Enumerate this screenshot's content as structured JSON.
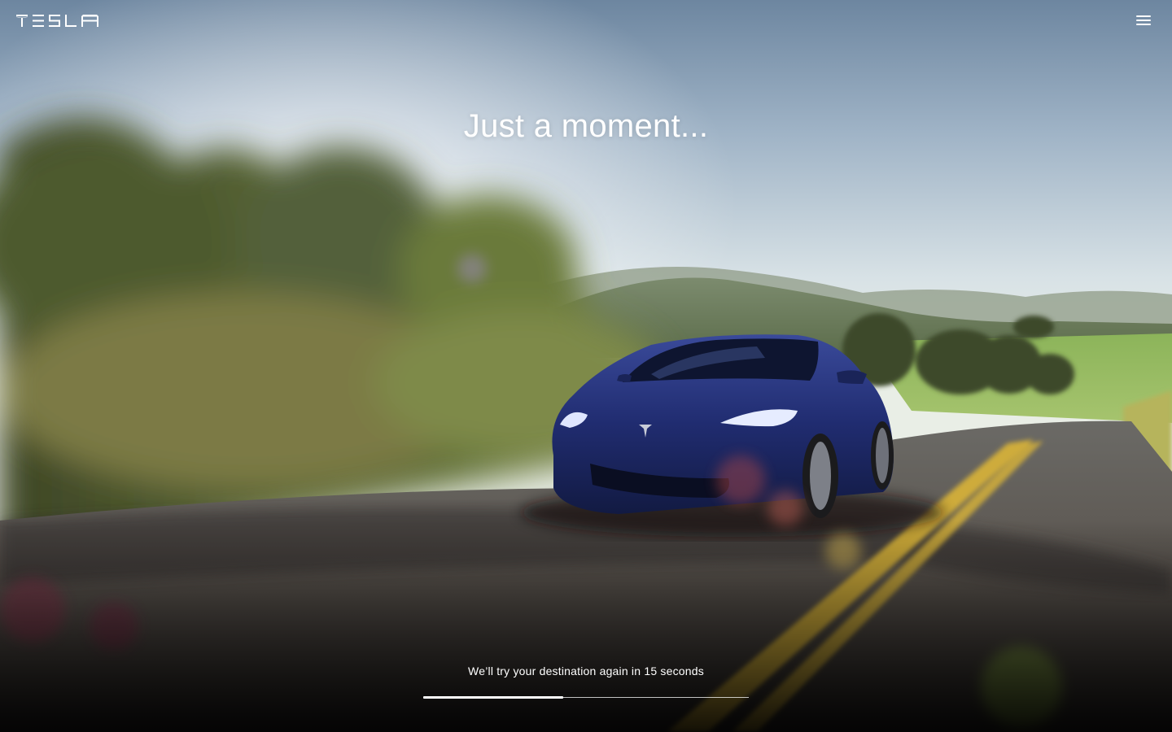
{
  "header": {
    "logo_text": "TESLA",
    "logo_icon": "tesla-wordmark-icon",
    "menu_icon": "hamburger-menu-icon"
  },
  "hero": {
    "headline": "Just a moment...",
    "image_description": "blue Tesla sedan driving on a rural road through green hills"
  },
  "retry": {
    "message_prefix": "We’ll try your destination again in",
    "seconds": "15",
    "message_suffix": "seconds"
  },
  "progress": {
    "fraction": 0.43
  },
  "colors": {
    "text": "#ffffff",
    "car_blue": "#1d2a6b",
    "road_yellow": "#d9b437"
  }
}
